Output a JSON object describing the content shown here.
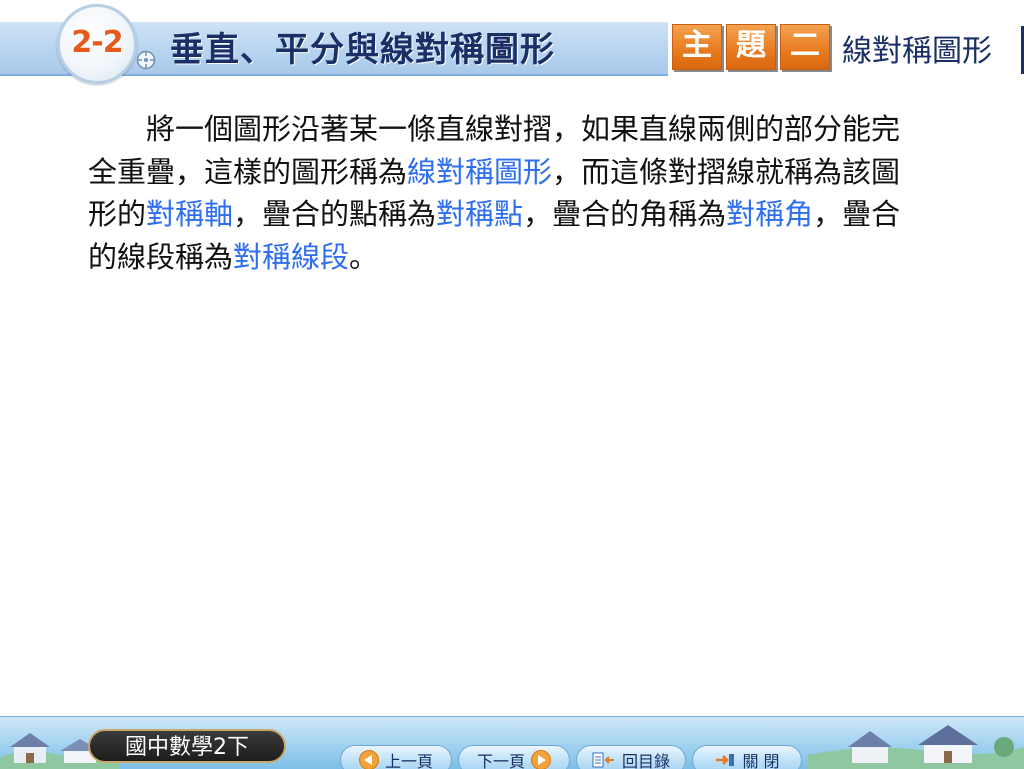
{
  "header": {
    "section_number": "2-2",
    "title": "垂直、平分與線對稱圖形",
    "topic_tiles": [
      "主",
      "題",
      "二"
    ],
    "topic_name": "線對稱圖形"
  },
  "content": {
    "segments": [
      {
        "text": "將一個圖形沿著某一條直線對摺，如果直線兩側的部分能完全重疊，這樣的圖形稱為",
        "term": false
      },
      {
        "text": "線對稱圖形",
        "term": true
      },
      {
        "text": "，而這條對摺線就稱為該圖形的",
        "term": false
      },
      {
        "text": "對稱軸",
        "term": true
      },
      {
        "text": "，疊合的點稱為",
        "term": false
      },
      {
        "text": "對稱點",
        "term": true
      },
      {
        "text": "，疊合的角稱為",
        "term": false
      },
      {
        "text": "對稱角",
        "term": true
      },
      {
        "text": "，疊合的線段稱為",
        "term": false
      },
      {
        "text": "對稱線段",
        "term": true
      },
      {
        "text": "。",
        "term": false
      }
    ]
  },
  "footer": {
    "book_label": "國中數學2下",
    "prev_label": "上一頁",
    "next_label": "下一頁",
    "toc_label": "回目錄",
    "close_label": "關 閉"
  },
  "colors": {
    "term_highlight": "#2e6ef0",
    "title_text": "#1a2f66",
    "topic_tile": "#e87a1e",
    "section_number": "#e85a1c"
  },
  "icons": [
    "compass-icon",
    "prev-arrow-icon",
    "next-arrow-icon",
    "toc-icon",
    "exit-icon"
  ]
}
